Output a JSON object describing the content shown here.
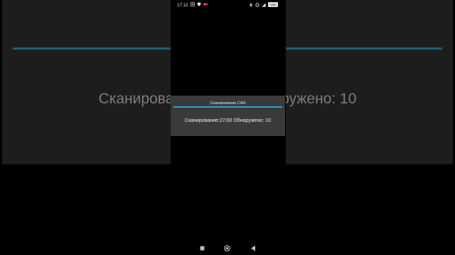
{
  "status_bar": {
    "time": "17:11",
    "battery": "100",
    "left_icons": [
      "notification-icon",
      "shield-icon",
      "video-icon"
    ],
    "right_icons": [
      "bluetooth-icon",
      "vibrate-icon",
      "signal-icon",
      "battery-icon"
    ]
  },
  "background": {
    "text": "Сканирование:27/30 Обнаружено: 10"
  },
  "dialog": {
    "title": "Сканирование CAN",
    "message": "Сканирование:27/30 Обнаружено: 10"
  },
  "colors": {
    "accent": "#2aa3d6",
    "dialog_bg": "#3a3a3a",
    "background_dim": "#1d1d1d"
  },
  "nav_bar": {
    "buttons": [
      "recents-icon",
      "home-icon",
      "back-icon"
    ]
  }
}
